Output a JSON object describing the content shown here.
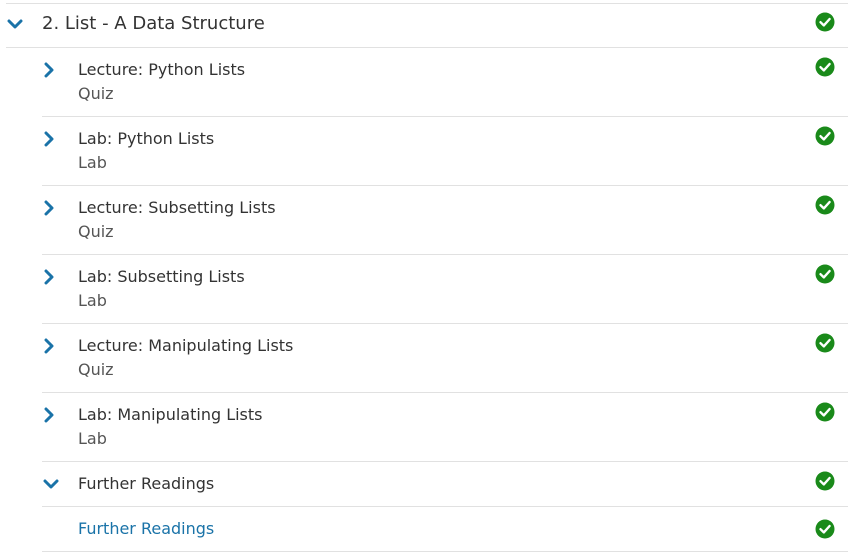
{
  "section": {
    "title": "2. List - A Data Structure",
    "expanded": true,
    "completed": true
  },
  "items": [
    {
      "title": "Lecture: Python Lists",
      "type": "Quiz",
      "completed": true
    },
    {
      "title": "Lab: Python Lists",
      "type": "Lab",
      "completed": true
    },
    {
      "title": "Lecture: Subsetting Lists",
      "type": "Quiz",
      "completed": true
    },
    {
      "title": "Lab: Subsetting Lists",
      "type": "Lab",
      "completed": true
    },
    {
      "title": "Lecture: Manipulating Lists",
      "type": "Quiz",
      "completed": true
    },
    {
      "title": "Lab: Manipulating Lists",
      "type": "Lab",
      "completed": true
    }
  ],
  "further": {
    "title": "Further Readings",
    "expanded": true,
    "completed": true,
    "child": {
      "title": "Further Readings",
      "completed": true
    }
  },
  "colors": {
    "accent": "#1a73a8",
    "check": "#1a8a1a",
    "divider": "#e1e1e1"
  }
}
